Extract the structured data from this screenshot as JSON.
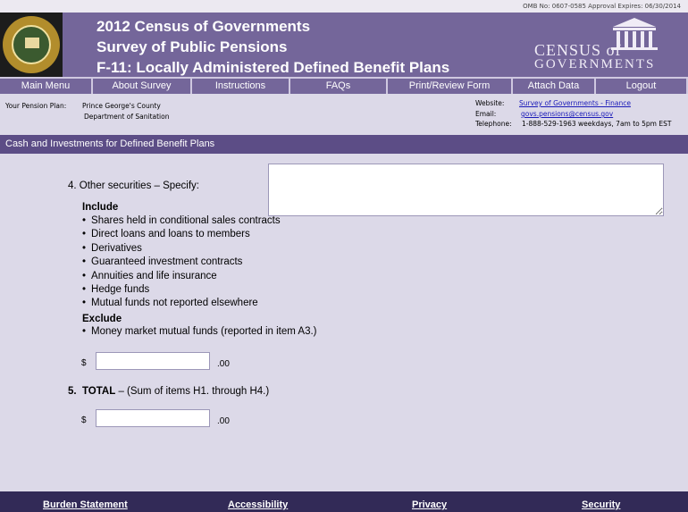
{
  "omb": "OMB No:  0607-0585  Approval Expires:  06/30/2014",
  "banner": {
    "line1": "2012 Census of Governments",
    "line2": "Survey of Public Pensions",
    "line3": "F-11:  Locally Administered Defined Benefit Plans",
    "logo_line1": "CENSUS of",
    "logo_line2": "GOVERNMENTS",
    "seal_text": "U.S. DEPARTMENT OF COMMERCE"
  },
  "nav": [
    {
      "label": "Main Menu"
    },
    {
      "label": "About Survey"
    },
    {
      "label": "Instructions"
    },
    {
      "label": "FAQs"
    },
    {
      "label": "Print/Review Form"
    },
    {
      "label": "Attach Data"
    },
    {
      "label": "Logout"
    }
  ],
  "info": {
    "plan_label": "Your Pension Plan:",
    "plan_name1": "Prince George's County",
    "plan_name2": "Department of Sanitation",
    "website_label": "Website:",
    "website_value": "Survey of Governments - Finance",
    "email_label": "Email:",
    "email_value": "govs.pensions@census.gov",
    "tel_label": "Telephone:",
    "tel_value": "1-888-529-1963  weekdays, 7am to 5pm EST"
  },
  "section_title": "Cash and Investments for Defined Benefit Plans",
  "item4": {
    "label": "4.  Other securities – Specify:",
    "include_head": "Include",
    "include_items": [
      "Shares held in conditional sales contracts",
      "Direct loans and loans to members",
      "Derivatives",
      "Guaranteed investment contracts",
      "Annuities and life insurance",
      "Hedge funds",
      "Mutual funds not reported elsewhere"
    ],
    "exclude_head": "Exclude",
    "exclude_items": [
      "Money market mutual funds (reported in item A3.)"
    ],
    "dollar": "$",
    "cents": ".00",
    "specify_value": "",
    "amount_value": ""
  },
  "item5": {
    "number": "5.",
    "label_bold": "TOTAL",
    "label_rest": " – (Sum of items H1. through H4.)",
    "dollar": "$",
    "cents": ".00",
    "amount_value": ""
  },
  "footer": {
    "burden": "Burden Statement",
    "accessibility": "Accessibility",
    "privacy": "Privacy",
    "security": "Security"
  }
}
